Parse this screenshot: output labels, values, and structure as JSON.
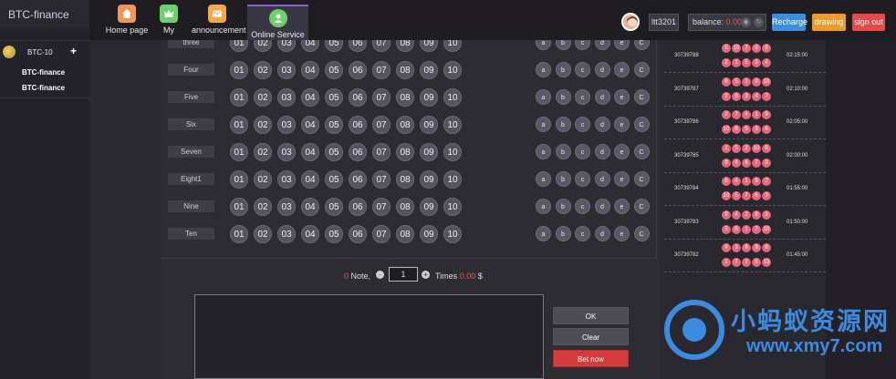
{
  "brand": "BTC-finance",
  "nav": [
    {
      "label": "Home page",
      "icon": "home-icon"
    },
    {
      "label": "My",
      "icon": "crown-icon"
    },
    {
      "label": "announcement",
      "icon": "envelope-icon"
    },
    {
      "label": "Online Service",
      "icon": "user-icon"
    }
  ],
  "user": {
    "name": "ltt3201"
  },
  "balance": {
    "label": "balance:",
    "value": "0.00"
  },
  "buttons": {
    "recharge": "Recharge",
    "drawing": "drawing",
    "signout": "sign out"
  },
  "sidebar": {
    "lottery": "BTC-10",
    "links": [
      "BTC-finance",
      "BTC-finance"
    ]
  },
  "rows": [
    "three",
    "Four",
    "Five",
    "Six",
    "Seven",
    "Eight1",
    "Nine",
    "Ten"
  ],
  "numbers": [
    "01",
    "02",
    "03",
    "04",
    "05",
    "06",
    "07",
    "08",
    "09",
    "10"
  ],
  "options": [
    "a",
    "b",
    "c",
    "d",
    "e",
    "C"
  ],
  "bet": {
    "note_count": "0",
    "note_label": "Note,",
    "times_value": "1",
    "times_label": "Times",
    "amount": "0.00",
    "currency": "$",
    "ok": "OK",
    "clear": "Clear",
    "bet_now": "Bet now"
  },
  "history": [
    {
      "issue": "30739788",
      "top": [
        "5",
        "10",
        "7",
        "8",
        "9"
      ],
      "bottom": [
        "2",
        "1",
        "5",
        "3",
        "4"
      ],
      "time": "02:15:00"
    },
    {
      "issue": "30739787",
      "top": [
        "6",
        "5",
        "1",
        "9",
        "10"
      ],
      "bottom": [
        "2",
        "8",
        "3",
        "4",
        "7"
      ],
      "time": "02:10:00"
    },
    {
      "issue": "30739786",
      "top": [
        "2",
        "7",
        "4",
        "1",
        "9"
      ],
      "bottom": [
        "10",
        "8",
        "5",
        "3",
        "6"
      ],
      "time": "02:05:00"
    },
    {
      "issue": "30739785",
      "top": [
        "1",
        "5",
        "2",
        "10",
        "8"
      ],
      "bottom": [
        "9",
        "4",
        "6",
        "7",
        "3"
      ],
      "time": "02:00:00"
    },
    {
      "issue": "30739784",
      "top": [
        "8",
        "4",
        "1",
        "9",
        "2"
      ],
      "bottom": [
        "10",
        "5",
        "7",
        "6",
        "3"
      ],
      "time": "01:55:00"
    },
    {
      "issue": "30739783",
      "top": [
        "9",
        "4",
        "2",
        "8",
        "3"
      ],
      "bottom": [
        "5",
        "6",
        "1",
        "7",
        "10"
      ],
      "time": "01:50:00"
    },
    {
      "issue": "30739782",
      "top": [
        "4",
        "3",
        "8",
        "9",
        "6"
      ],
      "bottom": [
        "1",
        "7",
        "2",
        "5",
        "10"
      ],
      "time": "01:45:00"
    }
  ],
  "watermark": {
    "title": "小蚂蚁资源网",
    "url": "www.xmy7.com"
  }
}
